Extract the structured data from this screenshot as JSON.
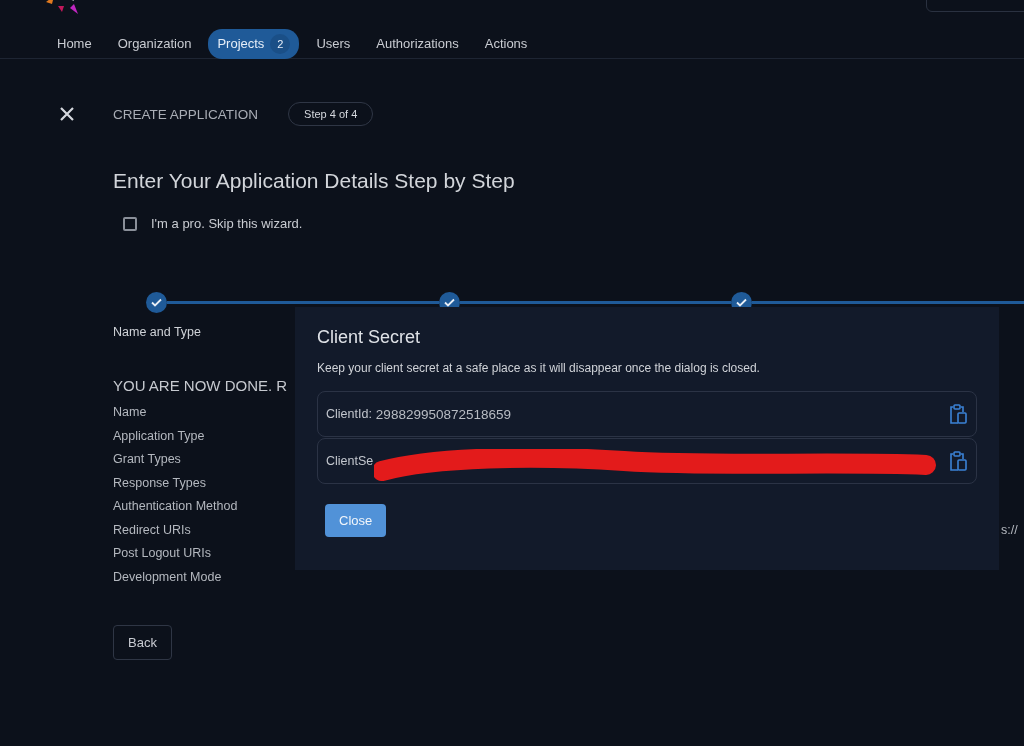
{
  "nav": {
    "items": [
      {
        "label": "Home",
        "selected": false
      },
      {
        "label": "Organization",
        "selected": false
      },
      {
        "label": "Projects",
        "selected": true,
        "badge": "2"
      },
      {
        "label": "Users",
        "selected": false
      },
      {
        "label": "Authorizations",
        "selected": false
      },
      {
        "label": "Actions",
        "selected": false
      }
    ]
  },
  "wizard": {
    "title": "CREATE APPLICATION",
    "step": "Step 4 of 4",
    "heading": "Enter Your Application Details Step by Step",
    "skip": {
      "label": "I'm a pro. Skip this wizard.",
      "checked": false
    },
    "steps": [
      {
        "label": "Name and Type",
        "done": true
      },
      {
        "done": true
      },
      {
        "done": true
      }
    ],
    "summary_title": "YOU ARE NOW DONE. R",
    "summary": [
      {
        "label": "Name"
      },
      {
        "label": "Application Type"
      },
      {
        "label": "Grant Types"
      },
      {
        "label": "Response Types"
      },
      {
        "label": "Authentication Method"
      },
      {
        "label": "Redirect URIs",
        "value": "s://"
      },
      {
        "label": "Post Logout URIs"
      },
      {
        "label": "Development Mode"
      }
    ],
    "back": "Back"
  },
  "dialog": {
    "title": "Client Secret",
    "text": "Keep your client secret at a safe place as it will disappear once the dialog is closed.",
    "fields": [
      {
        "label": "ClientId:",
        "value": "298829950872518659"
      },
      {
        "label": "ClientSe",
        "redacted": true
      }
    ],
    "close": "Close"
  }
}
